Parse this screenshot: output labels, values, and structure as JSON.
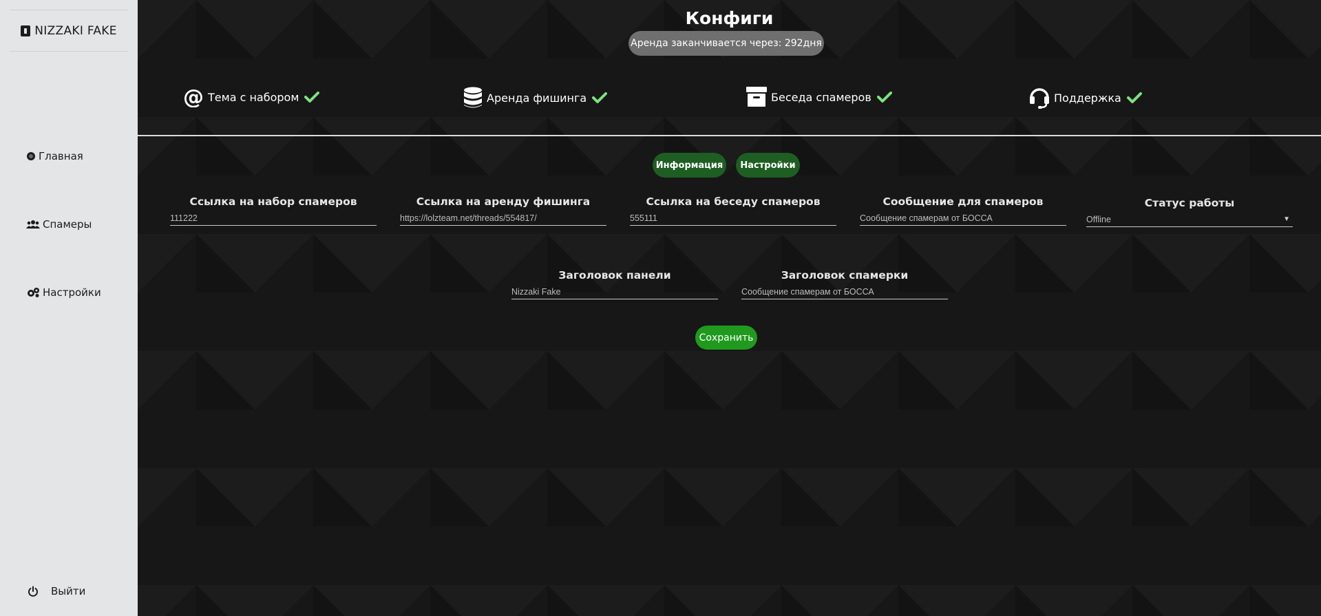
{
  "brand": {
    "name": "NIZZAKI FAKE"
  },
  "sidebar": {
    "items": [
      {
        "label": "Главная",
        "icon": "dot-icon"
      },
      {
        "label": "Спамеры",
        "icon": "users-icon"
      },
      {
        "label": "Настройки",
        "icon": "gears-icon"
      }
    ],
    "logout_label": "Выйти"
  },
  "header": {
    "title": "Конфиги",
    "lease": "Аренда заканчивается через: 292дня"
  },
  "status": [
    {
      "label": "Тема с набором",
      "icon": "at-icon",
      "ok": true
    },
    {
      "label": "Аренда фишинга",
      "icon": "database-icon",
      "ok": true
    },
    {
      "label": "Беседа спамеров",
      "icon": "archive-icon",
      "ok": true
    },
    {
      "label": "Поддержка",
      "icon": "headset-icon",
      "ok": true
    }
  ],
  "tabs": {
    "info": "Информация",
    "settings": "Настройки"
  },
  "fields": {
    "recruit_link": {
      "label": "Ссылка на набор спамеров",
      "value": "111222"
    },
    "phishing_link": {
      "label": "Ссылка на аренду фишинга",
      "value": "https://lolzteam.net/threads/554817/"
    },
    "chat_link": {
      "label": "Ссылка на беседу спамеров",
      "value": "555111"
    },
    "message": {
      "label": "Сообщение для спамеров",
      "value": "Сообщение спамерам от БОССА"
    },
    "work_status": {
      "label": "Статус работы",
      "value": "Offline"
    },
    "panel_title": {
      "label": "Заголовок панели",
      "value": "Nizzaki Fake"
    },
    "spam_title": {
      "label": "Заголовок спамерки",
      "value": "Сообщение спамерам от БОССА"
    }
  },
  "save_label": "Сохранить",
  "colors": {
    "sidebar_bg": "#e4e5e7",
    "main_bg": "#171717",
    "tab_green": "#1f5e23",
    "save_green": "#1f9a1f",
    "check_green": "#7ee27e",
    "pill_gray": "#6f6f6f"
  }
}
